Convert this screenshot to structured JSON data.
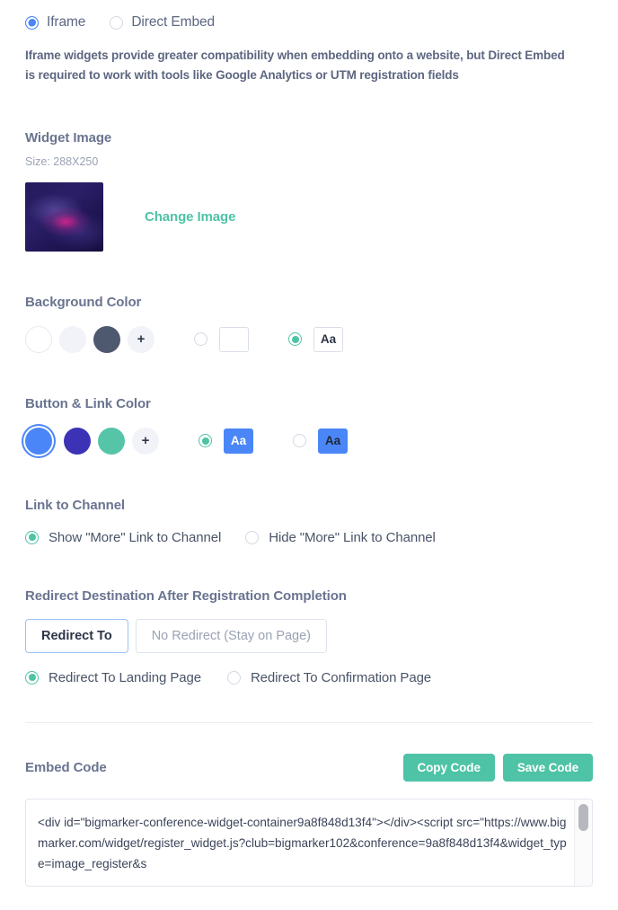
{
  "embed_type": {
    "options": [
      {
        "label": "Iframe",
        "selected": true
      },
      {
        "label": "Direct Embed",
        "selected": false
      }
    ],
    "note": "Iframe widgets provide greater compatibility when embedding onto a website, but Direct Embed is required to work with tools like Google Analytics or UTM registration fields"
  },
  "widget_image": {
    "heading": "Widget Image",
    "size_note": "Size: 288X250",
    "change_link": "Change Image"
  },
  "background_color": {
    "heading": "Background Color",
    "swatches": [
      "#ffffff",
      "#f1f3f8",
      "#4e586f"
    ],
    "add_label": "+",
    "text_options": [
      {
        "selected": false,
        "chip_label": "",
        "chip_bg": "#ffffff",
        "chip_fg": "#2c3447"
      },
      {
        "selected": true,
        "chip_label": "Aa",
        "chip_bg": "#ffffff",
        "chip_fg": "#2c3447"
      }
    ]
  },
  "button_link_color": {
    "heading": "Button & Link Color",
    "swatches": [
      "#4a86f7",
      "#3b32b5",
      "#56c4a7"
    ],
    "add_label": "+",
    "text_options": [
      {
        "selected": true,
        "chip_label": "Aa",
        "chip_bg": "#4a86f7",
        "chip_fg": "#ffffff"
      },
      {
        "selected": false,
        "chip_label": "Aa",
        "chip_bg": "#4a86f7",
        "chip_fg": "#1d2739"
      }
    ]
  },
  "link_to_channel": {
    "heading": "Link to Channel",
    "options": [
      {
        "label": "Show \"More\" Link to Channel",
        "selected": true
      },
      {
        "label": "Hide \"More\" Link to Channel",
        "selected": false
      }
    ]
  },
  "redirect": {
    "heading": "Redirect Destination After Registration Completion",
    "tabs": [
      {
        "label": "Redirect To",
        "active": true
      },
      {
        "label": "No Redirect (Stay on Page)",
        "active": false
      }
    ],
    "options": [
      {
        "label": "Redirect To Landing Page",
        "selected": true
      },
      {
        "label": "Redirect To Confirmation Page",
        "selected": false
      }
    ]
  },
  "embed_code": {
    "heading": "Embed Code",
    "copy_label": "Copy Code",
    "save_label": "Save Code",
    "code": "<div id=\"bigmarker-conference-widget-container9a8f848d13f4\"></div><script src=\"https://www.bigmarker.com/widget/register_widget.js?club=bigmarker102&conference=9a8f848d13f4&widget_type=image_register&s"
  },
  "colors": {
    "accent_teal": "#4ec3a6",
    "accent_blue": "#4a86f7",
    "heading_grey": "#6a7490",
    "body_grey": "#5d6781"
  }
}
